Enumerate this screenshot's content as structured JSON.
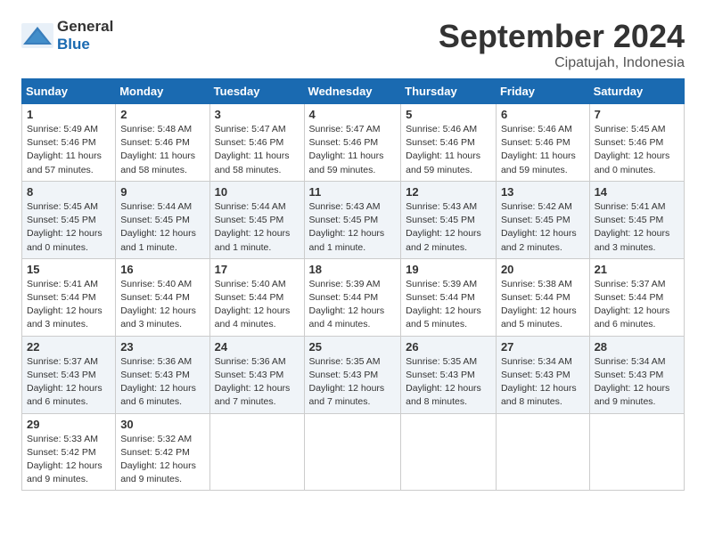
{
  "logo": {
    "text_general": "General",
    "text_blue": "Blue"
  },
  "title": {
    "month_year": "September 2024",
    "location": "Cipatujah, Indonesia"
  },
  "weekdays": [
    "Sunday",
    "Monday",
    "Tuesday",
    "Wednesday",
    "Thursday",
    "Friday",
    "Saturday"
  ],
  "weeks": [
    [
      {
        "day": "1",
        "sunrise": "5:49 AM",
        "sunset": "5:46 PM",
        "daylight": "11 hours and 57 minutes."
      },
      {
        "day": "2",
        "sunrise": "5:48 AM",
        "sunset": "5:46 PM",
        "daylight": "11 hours and 58 minutes."
      },
      {
        "day": "3",
        "sunrise": "5:47 AM",
        "sunset": "5:46 PM",
        "daylight": "11 hours and 58 minutes."
      },
      {
        "day": "4",
        "sunrise": "5:47 AM",
        "sunset": "5:46 PM",
        "daylight": "11 hours and 59 minutes."
      },
      {
        "day": "5",
        "sunrise": "5:46 AM",
        "sunset": "5:46 PM",
        "daylight": "11 hours and 59 minutes."
      },
      {
        "day": "6",
        "sunrise": "5:46 AM",
        "sunset": "5:46 PM",
        "daylight": "11 hours and 59 minutes."
      },
      {
        "day": "7",
        "sunrise": "5:45 AM",
        "sunset": "5:46 PM",
        "daylight": "12 hours and 0 minutes."
      }
    ],
    [
      {
        "day": "8",
        "sunrise": "5:45 AM",
        "sunset": "5:45 PM",
        "daylight": "12 hours and 0 minutes."
      },
      {
        "day": "9",
        "sunrise": "5:44 AM",
        "sunset": "5:45 PM",
        "daylight": "12 hours and 1 minute."
      },
      {
        "day": "10",
        "sunrise": "5:44 AM",
        "sunset": "5:45 PM",
        "daylight": "12 hours and 1 minute."
      },
      {
        "day": "11",
        "sunrise": "5:43 AM",
        "sunset": "5:45 PM",
        "daylight": "12 hours and 1 minute."
      },
      {
        "day": "12",
        "sunrise": "5:43 AM",
        "sunset": "5:45 PM",
        "daylight": "12 hours and 2 minutes."
      },
      {
        "day": "13",
        "sunrise": "5:42 AM",
        "sunset": "5:45 PM",
        "daylight": "12 hours and 2 minutes."
      },
      {
        "day": "14",
        "sunrise": "5:41 AM",
        "sunset": "5:45 PM",
        "daylight": "12 hours and 3 minutes."
      }
    ],
    [
      {
        "day": "15",
        "sunrise": "5:41 AM",
        "sunset": "5:44 PM",
        "daylight": "12 hours and 3 minutes."
      },
      {
        "day": "16",
        "sunrise": "5:40 AM",
        "sunset": "5:44 PM",
        "daylight": "12 hours and 3 minutes."
      },
      {
        "day": "17",
        "sunrise": "5:40 AM",
        "sunset": "5:44 PM",
        "daylight": "12 hours and 4 minutes."
      },
      {
        "day": "18",
        "sunrise": "5:39 AM",
        "sunset": "5:44 PM",
        "daylight": "12 hours and 4 minutes."
      },
      {
        "day": "19",
        "sunrise": "5:39 AM",
        "sunset": "5:44 PM",
        "daylight": "12 hours and 5 minutes."
      },
      {
        "day": "20",
        "sunrise": "5:38 AM",
        "sunset": "5:44 PM",
        "daylight": "12 hours and 5 minutes."
      },
      {
        "day": "21",
        "sunrise": "5:37 AM",
        "sunset": "5:44 PM",
        "daylight": "12 hours and 6 minutes."
      }
    ],
    [
      {
        "day": "22",
        "sunrise": "5:37 AM",
        "sunset": "5:43 PM",
        "daylight": "12 hours and 6 minutes."
      },
      {
        "day": "23",
        "sunrise": "5:36 AM",
        "sunset": "5:43 PM",
        "daylight": "12 hours and 6 minutes."
      },
      {
        "day": "24",
        "sunrise": "5:36 AM",
        "sunset": "5:43 PM",
        "daylight": "12 hours and 7 minutes."
      },
      {
        "day": "25",
        "sunrise": "5:35 AM",
        "sunset": "5:43 PM",
        "daylight": "12 hours and 7 minutes."
      },
      {
        "day": "26",
        "sunrise": "5:35 AM",
        "sunset": "5:43 PM",
        "daylight": "12 hours and 8 minutes."
      },
      {
        "day": "27",
        "sunrise": "5:34 AM",
        "sunset": "5:43 PM",
        "daylight": "12 hours and 8 minutes."
      },
      {
        "day": "28",
        "sunrise": "5:34 AM",
        "sunset": "5:43 PM",
        "daylight": "12 hours and 9 minutes."
      }
    ],
    [
      {
        "day": "29",
        "sunrise": "5:33 AM",
        "sunset": "5:42 PM",
        "daylight": "12 hours and 9 minutes."
      },
      {
        "day": "30",
        "sunrise": "5:32 AM",
        "sunset": "5:42 PM",
        "daylight": "12 hours and 9 minutes."
      },
      null,
      null,
      null,
      null,
      null
    ]
  ]
}
